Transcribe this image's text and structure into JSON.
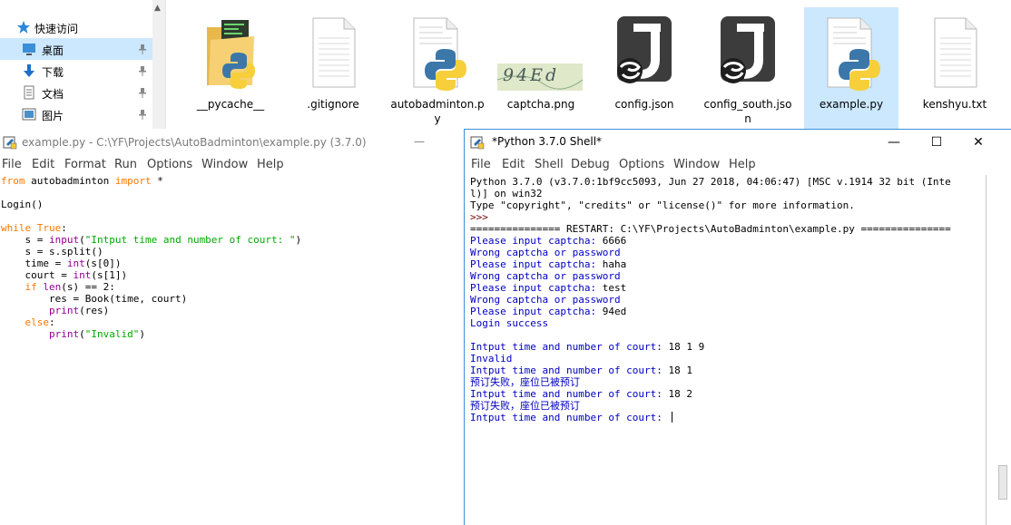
{
  "explorer": {
    "nav": {
      "quick_access": "快速访问",
      "desktop": "桌面",
      "downloads": "下载",
      "documents": "文档",
      "pictures": "图片"
    },
    "files": [
      {
        "name": "__pycache__",
        "icon": "folder-icon"
      },
      {
        "name": ".gitignore",
        "icon": "text-file-icon"
      },
      {
        "name": "autobadminton.py",
        "icon": "python-file-icon"
      },
      {
        "name": "captcha.png",
        "icon": "image-thumbnail-icon",
        "thumb_text": "94Ed"
      },
      {
        "name": "config.json",
        "icon": "json-file-icon"
      },
      {
        "name": "config_south.json",
        "icon": "json-file-icon"
      },
      {
        "name": "example.py",
        "icon": "python-file-icon",
        "selected": true
      },
      {
        "name": "kenshyu.txt",
        "icon": "text-file-icon"
      }
    ]
  },
  "editor": {
    "title": "example.py - C:\\YF\\Projects\\AutoBadminton\\example.py (3.7.0)",
    "minimize": "—",
    "menu": [
      "File",
      "Edit",
      "Format",
      "Run",
      "Options",
      "Window",
      "Help"
    ],
    "code": [
      [
        {
          "t": "from",
          "c": "kw"
        },
        {
          "t": " autobadminton ",
          "c": "norm"
        },
        {
          "t": "import",
          "c": "kw"
        },
        {
          "t": " *",
          "c": "norm"
        }
      ],
      [],
      [
        {
          "t": "Login()",
          "c": "norm"
        }
      ],
      [],
      [
        {
          "t": "while",
          "c": "kw"
        },
        {
          "t": " ",
          "c": "norm"
        },
        {
          "t": "True",
          "c": "kw"
        },
        {
          "t": ":",
          "c": "norm"
        }
      ],
      [
        {
          "t": "    s = ",
          "c": "norm"
        },
        {
          "t": "input",
          "c": "bi"
        },
        {
          "t": "(",
          "c": "norm"
        },
        {
          "t": "\"Intput time and number of court: \"",
          "c": "str"
        },
        {
          "t": ")",
          "c": "norm"
        }
      ],
      [
        {
          "t": "    s = s.split()",
          "c": "norm"
        }
      ],
      [
        {
          "t": "    time = ",
          "c": "norm"
        },
        {
          "t": "int",
          "c": "bi"
        },
        {
          "t": "(s[0])",
          "c": "norm"
        }
      ],
      [
        {
          "t": "    court = ",
          "c": "norm"
        },
        {
          "t": "int",
          "c": "bi"
        },
        {
          "t": "(s[1])",
          "c": "norm"
        }
      ],
      [
        {
          "t": "    ",
          "c": "norm"
        },
        {
          "t": "if",
          "c": "kw"
        },
        {
          "t": " ",
          "c": "norm"
        },
        {
          "t": "len",
          "c": "bi"
        },
        {
          "t": "(s) == 2:",
          "c": "norm"
        }
      ],
      [
        {
          "t": "        res = Book(time, court)",
          "c": "norm"
        }
      ],
      [
        {
          "t": "        ",
          "c": "norm"
        },
        {
          "t": "print",
          "c": "bi"
        },
        {
          "t": "(res)",
          "c": "norm"
        }
      ],
      [
        {
          "t": "    ",
          "c": "norm"
        },
        {
          "t": "else",
          "c": "kw"
        },
        {
          "t": ":",
          "c": "norm"
        }
      ],
      [
        {
          "t": "        ",
          "c": "norm"
        },
        {
          "t": "print",
          "c": "bi"
        },
        {
          "t": "(",
          "c": "norm"
        },
        {
          "t": "\"Invalid\"",
          "c": "str"
        },
        {
          "t": ")",
          "c": "norm"
        }
      ]
    ]
  },
  "shell": {
    "title": "*Python 3.7.0 Shell*",
    "buttons": {
      "minimize": "—",
      "maximize": "☐",
      "close": "✕"
    },
    "menu": [
      "File",
      "Edit",
      "Shell",
      "Debug",
      "Options",
      "Window",
      "Help"
    ],
    "lines": [
      [
        {
          "t": "Python 3.7.0 (v3.7.0:1bf9cc5093, Jun 27 2018, 04:06:47) [MSC v.1914 32 bit (Inte",
          "c": "norm"
        }
      ],
      [
        {
          "t": "l)] on win32",
          "c": "norm"
        }
      ],
      [
        {
          "t": "Type \"copyright\", \"credits\" or \"license()\" for more information.",
          "c": "norm"
        }
      ],
      [
        {
          "t": ">>>",
          "c": "prompt"
        }
      ],
      [
        {
          "t": "=============== RESTART: C:\\YF\\Projects\\AutoBadminton\\example.py ===============",
          "c": "norm"
        }
      ],
      [
        {
          "t": "Please input captcha: ",
          "c": "out"
        },
        {
          "t": "6666",
          "c": "norm"
        }
      ],
      [
        {
          "t": "Wrong captcha or password",
          "c": "out"
        }
      ],
      [
        {
          "t": "Please input captcha: ",
          "c": "out"
        },
        {
          "t": "haha",
          "c": "norm"
        }
      ],
      [
        {
          "t": "Wrong captcha or password",
          "c": "out"
        }
      ],
      [
        {
          "t": "Please input captcha: ",
          "c": "out"
        },
        {
          "t": "test",
          "c": "norm"
        }
      ],
      [
        {
          "t": "Wrong captcha or password",
          "c": "out"
        }
      ],
      [
        {
          "t": "Please input captcha: ",
          "c": "out"
        },
        {
          "t": "94ed",
          "c": "norm"
        }
      ],
      [
        {
          "t": "Login success",
          "c": "out"
        }
      ],
      [],
      [
        {
          "t": "Intput time and number of court: ",
          "c": "out"
        },
        {
          "t": "18 1 9",
          "c": "norm"
        }
      ],
      [
        {
          "t": "Invalid",
          "c": "out"
        }
      ],
      [
        {
          "t": "Intput time and number of court: ",
          "c": "out"
        },
        {
          "t": "18 1",
          "c": "norm"
        }
      ],
      [
        {
          "t": "预订失败，座位已被预订",
          "c": "out"
        }
      ],
      [
        {
          "t": "Intput time and number of court: ",
          "c": "out"
        },
        {
          "t": "18 2",
          "c": "norm"
        }
      ],
      [
        {
          "t": "预订失败，座位已被预订",
          "c": "out"
        }
      ],
      [
        {
          "t": "Intput time and number of court: ",
          "c": "out"
        }
      ]
    ]
  }
}
